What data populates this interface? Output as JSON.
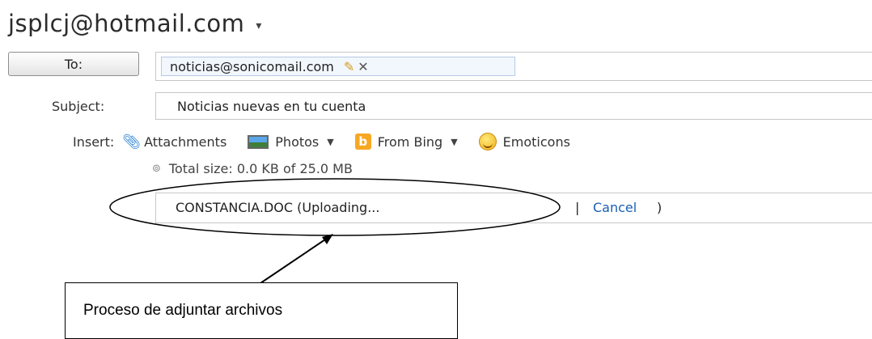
{
  "account": {
    "email": "jsplcj@hotmail.com",
    "caret": "▾"
  },
  "to": {
    "button_label": "To:",
    "recipient": "noticias@sonicomail.com"
  },
  "subject": {
    "label": "Subject:",
    "value": "Noticias nuevas en tu cuenta"
  },
  "insert": {
    "label": "Insert:",
    "items": [
      {
        "label": "Attachments",
        "icon": "paperclip-icon"
      },
      {
        "label": "Photos",
        "icon": "photo-icon"
      },
      {
        "label": "From Bing",
        "icon": "bing-icon"
      },
      {
        "label": "Emoticons",
        "icon": "emoticon-icon"
      }
    ]
  },
  "total_size": "Total size: 0.0 KB of 25.0 MB",
  "upload": {
    "name": "CONSTANCIA.DOC (Uploading...",
    "cancel": "Cancel",
    "close_paren": ")"
  },
  "callout": {
    "text": "Proceso de adjuntar archivos"
  },
  "colors": {
    "link": "#1a5fb4",
    "attach_icon": "#1e7bd3",
    "recipient_bg": "#f2f7fd"
  }
}
